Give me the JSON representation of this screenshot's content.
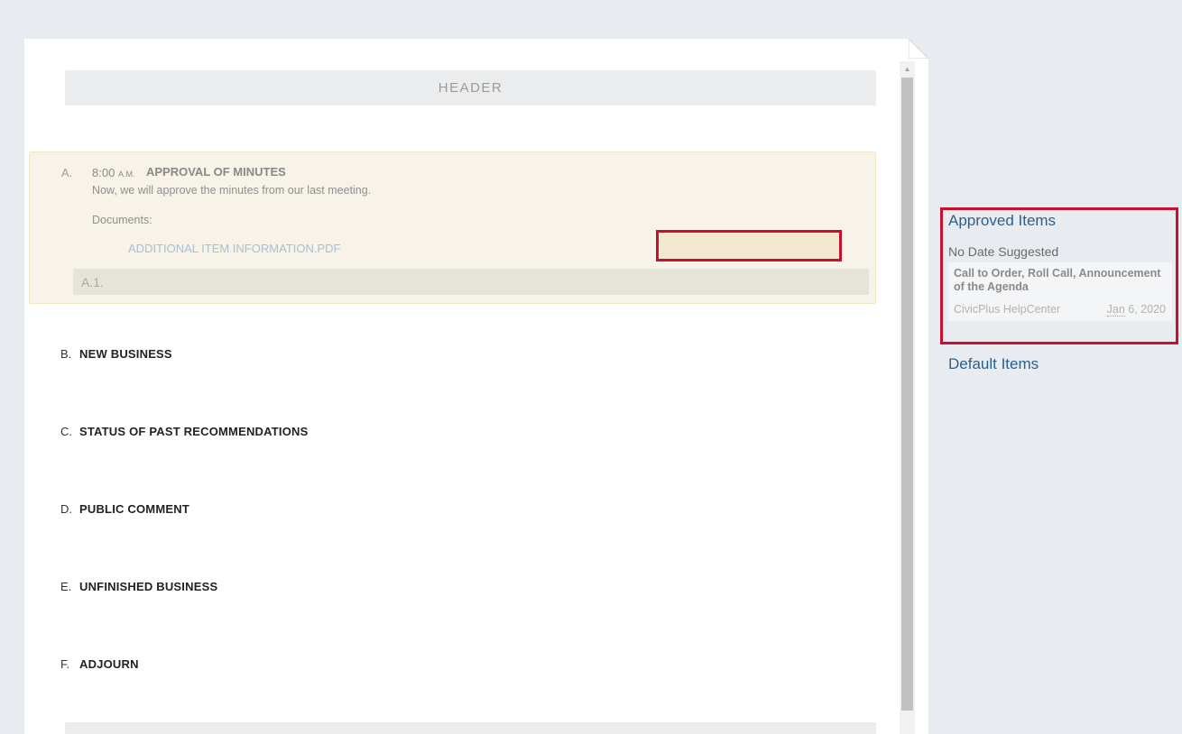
{
  "document": {
    "header_label": "HEADER",
    "item_a": {
      "letter": "A.",
      "time": "8:00",
      "ampm": "A.M.",
      "title": "APPROVAL OF MINUTES",
      "description": "Now, we will approve the minutes from our last meeting.",
      "documents_label": "Documents:",
      "document_link": "ADDITIONAL ITEM INFORMATION.PDF",
      "subitem_label": "A.1."
    },
    "items": [
      {
        "letter": "B.",
        "title": "NEW BUSINESS"
      },
      {
        "letter": "C.",
        "title": "STATUS OF PAST RECOMMENDATIONS"
      },
      {
        "letter": "D.",
        "title": "PUBLIC COMMENT"
      },
      {
        "letter": "E.",
        "title": "UNFINISHED BUSINESS"
      },
      {
        "letter": "F.",
        "title": "ADJOURN"
      }
    ]
  },
  "panel": {
    "approved_title": "Approved Items",
    "no_date_label": "No Date Suggested",
    "approved_card": {
      "title": "Call to Order, Roll Call, Announcement of the Agenda",
      "source": "CivicPlus HelpCenter",
      "date_month": "Jan",
      "date_rest": " 6, 2020"
    },
    "default_title": "Default Items"
  },
  "colors": {
    "highlight_border": "#c8102e",
    "link_blue": "#2e5f8a",
    "item_highlight_bg": "#f7f3e8"
  },
  "icons": {
    "scroll_up": "triangle-up-icon",
    "page_fold": "page-corner-fold-icon"
  }
}
